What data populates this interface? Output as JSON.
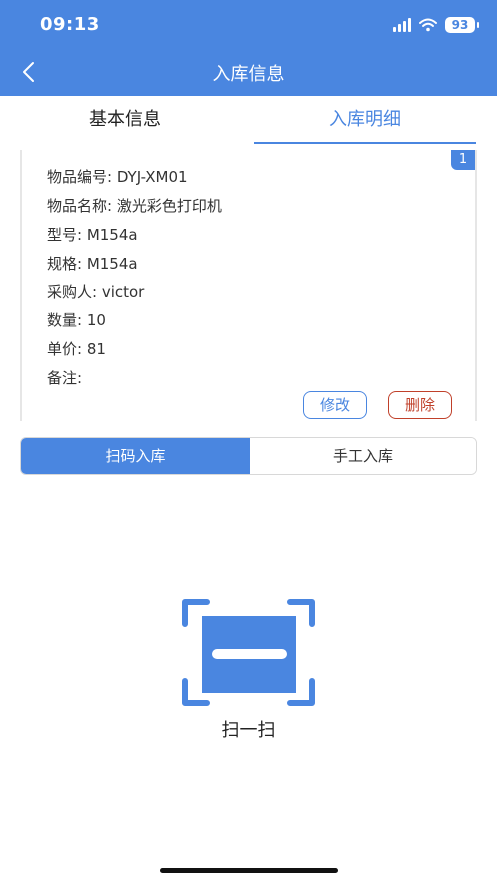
{
  "status": {
    "time": "09:13",
    "battery": "93"
  },
  "nav": {
    "title": "入库信息"
  },
  "tabs": [
    {
      "label": "基本信息"
    },
    {
      "label": "入库明细"
    }
  ],
  "item": {
    "index": "1",
    "fields": [
      "物品编号: DYJ-XM01",
      "物品名称: 激光彩色打印机",
      "型号: M154a",
      "规格: M154a",
      "采购人: victor",
      "数量: 10",
      "单价: 81",
      "备注:"
    ],
    "edit_label": "修改",
    "delete_label": "删除"
  },
  "modes": {
    "scan_label": "扫码入库",
    "manual_label": "手工入库"
  },
  "scan": {
    "label": "扫一扫",
    "icon": "scan-icon"
  },
  "colors": {
    "primary": "#4a86e0",
    "danger": "#c0402a"
  }
}
